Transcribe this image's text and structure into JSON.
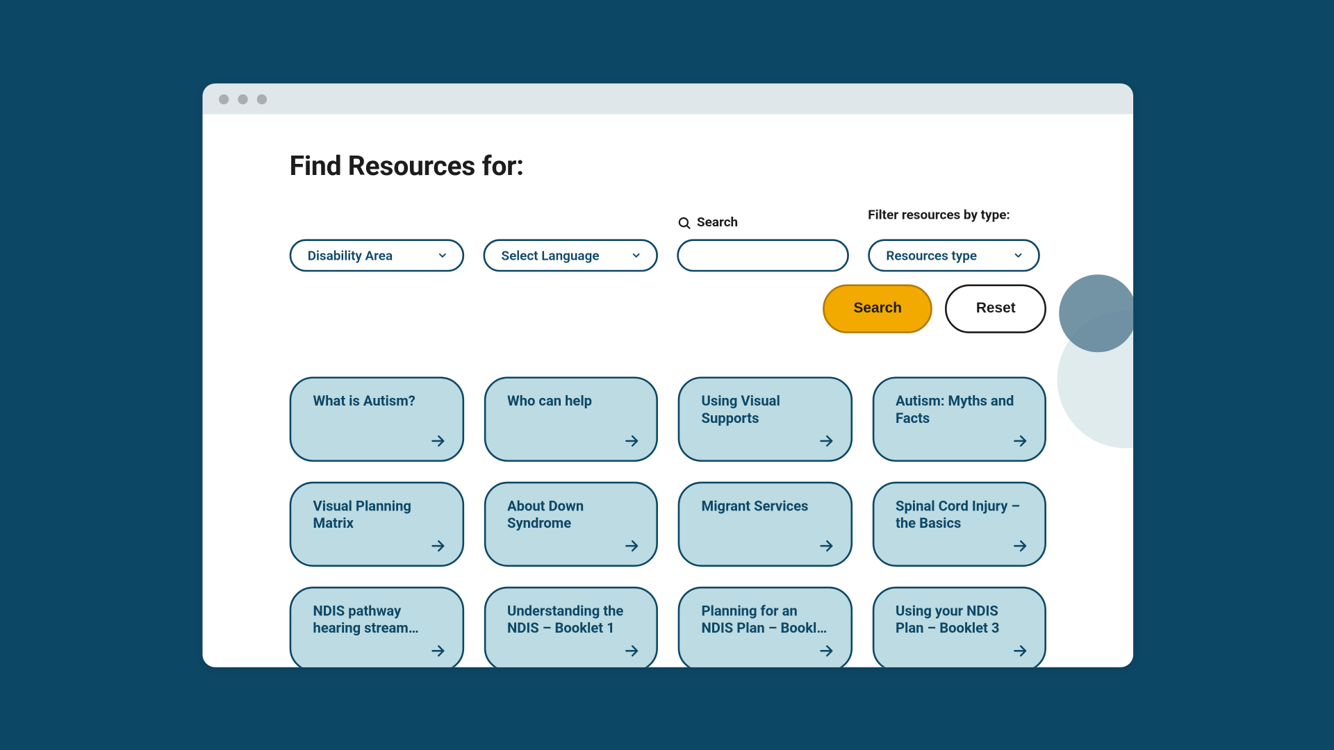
{
  "page": {
    "title": "Find Resources for:"
  },
  "filters": {
    "disability": {
      "label": "Disability Area"
    },
    "language": {
      "label": "Select Language"
    },
    "search": {
      "label": "Search",
      "value": ""
    },
    "type": {
      "group_label": "Filter resources by type:",
      "label": "Resources type"
    }
  },
  "actions": {
    "search": "Search",
    "reset": "Reset"
  },
  "cards": [
    {
      "title": "What is Autism?"
    },
    {
      "title": "Who can help"
    },
    {
      "title": "Using Visual Supports"
    },
    {
      "title": "Autism: Myths and Facts"
    },
    {
      "title": "Visual Planning Matrix"
    },
    {
      "title": "About Down Syndrome"
    },
    {
      "title": "Migrant Services"
    },
    {
      "title": "Spinal Cord Injury – the Basics"
    },
    {
      "title": "NDIS pathway hearing stream…"
    },
    {
      "title": "Understanding the NDIS – Booklet 1"
    },
    {
      "title": "Planning for an NDIS Plan – Bookl…"
    },
    {
      "title": "Using your NDIS Plan – Booklet 3"
    }
  ],
  "colors": {
    "bg": "#0d4766",
    "accent": "#f2a900",
    "card": "#bcdbe2"
  }
}
